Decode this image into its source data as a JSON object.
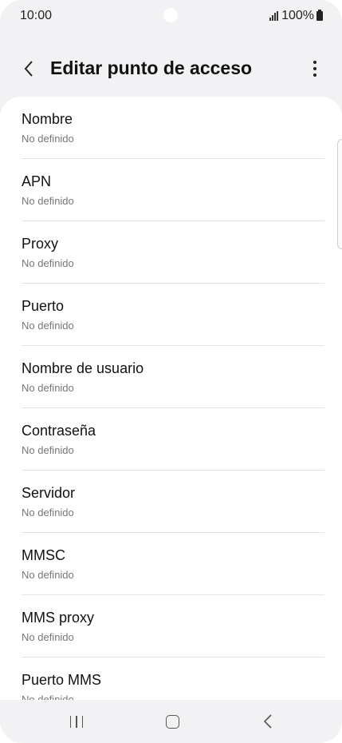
{
  "status_bar": {
    "time": "10:00",
    "battery": "100%"
  },
  "app_bar": {
    "title": "Editar punto de acceso",
    "back_icon": "chevron-left-icon",
    "more_icon": "more-vertical-icon"
  },
  "list": {
    "items": [
      {
        "title": "Nombre",
        "value": "No definido"
      },
      {
        "title": "APN",
        "value": "No definido"
      },
      {
        "title": "Proxy",
        "value": "No definido"
      },
      {
        "title": "Puerto",
        "value": "No definido"
      },
      {
        "title": "Nombre de usuario",
        "value": "No definido"
      },
      {
        "title": "Contraseña",
        "value": "No definido"
      },
      {
        "title": "Servidor",
        "value": "No definido"
      },
      {
        "title": "MMSC",
        "value": "No definido"
      },
      {
        "title": "MMS proxy",
        "value": "No definido"
      },
      {
        "title": "Puerto MMS",
        "value": "No definido"
      }
    ]
  },
  "nav_bar": {
    "recents_icon": "recents-icon",
    "home_icon": "home-icon",
    "back_icon": "back-icon"
  },
  "colors": {
    "background": "#f2f2f4",
    "card": "#ffffff",
    "text": "#111111",
    "secondary_text": "#777777"
  }
}
